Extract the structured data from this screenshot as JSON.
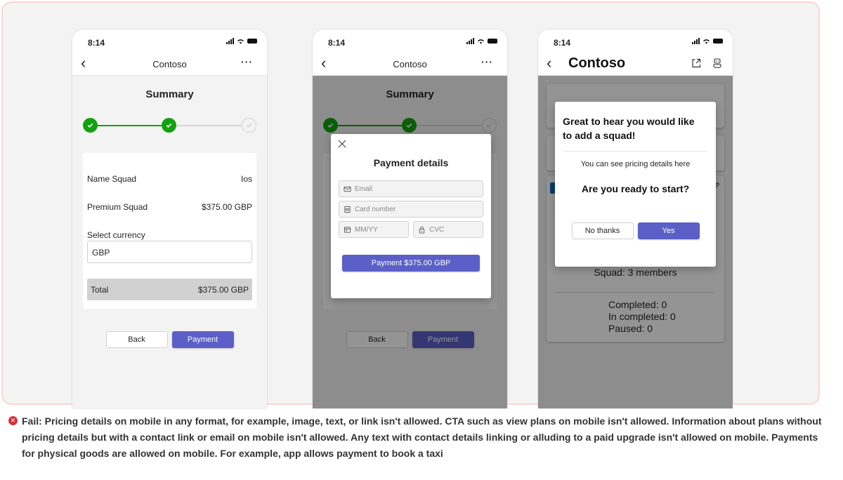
{
  "colors": {
    "accent": "#5b5fc7",
    "success": "#13a10e",
    "fail": "#d13438",
    "frame_border": "#fbd4d8"
  },
  "status_bar": {
    "time": "8:14",
    "icons": [
      "signal-icon",
      "wifi-icon",
      "battery-icon"
    ]
  },
  "screen1": {
    "nav": {
      "back_icon": "chevron-left-icon",
      "title": "Contoso",
      "more_icon": "more-horizontal-icon",
      "more_glyph": "···"
    },
    "summary_title": "Summary",
    "stepper": {
      "steps": [
        {
          "state": "done"
        },
        {
          "state": "done"
        },
        {
          "state": "pending"
        }
      ]
    },
    "rows": [
      {
        "label": "Name Squad",
        "value": "Ios"
      },
      {
        "label": "Premium Squad",
        "value": "$375.00 GBP"
      }
    ],
    "currency_label": "Select currency",
    "currency_value": "GBP",
    "total_label": "Total",
    "total_value": "$375.00 GBP",
    "back_button": "Back",
    "payment_button": "Payment"
  },
  "screen2": {
    "nav": {
      "title": "Contoso",
      "more_glyph": "···"
    },
    "summary_title": "Summary",
    "back_button": "Back",
    "payment_button": "Payment",
    "dialog": {
      "title": "Payment details",
      "close_icon": "close-icon",
      "email_placeholder": "Email",
      "card_placeholder": "Card number",
      "expiry_placeholder": "MM/YY",
      "cvc_placeholder": "CVC",
      "submit_label": "Payment $375.00 GBP"
    }
  },
  "screen3": {
    "nav": {
      "title": "Contoso",
      "share_icon": "open-external-icon",
      "bot_icon": "bot-icon"
    },
    "squad_text": "Squad: 3 members",
    "stats": [
      "Completed: 0",
      "In completed: 0",
      "Paused: 0"
    ],
    "dialog": {
      "heading": "Great to hear you would like to add a squad!",
      "subtext": "You can see pricing details here",
      "question": "Are you ready to start?",
      "no_button": "No thanks",
      "yes_button": "Yes"
    }
  },
  "verdict": {
    "icon": "fail-icon",
    "text": "Fail: Pricing details on mobile in any format, for example, image, text, or link isn't allowed. CTA such as view plans on mobile isn't allowed. Information about plans without pricing details but with a contact link or email on mobile isn't allowed. Any text with contact details linking or alluding to a paid upgrade isn't allowed on mobile. Payments for physical goods are allowed on mobile. For example, app allows payment to book a taxi"
  }
}
